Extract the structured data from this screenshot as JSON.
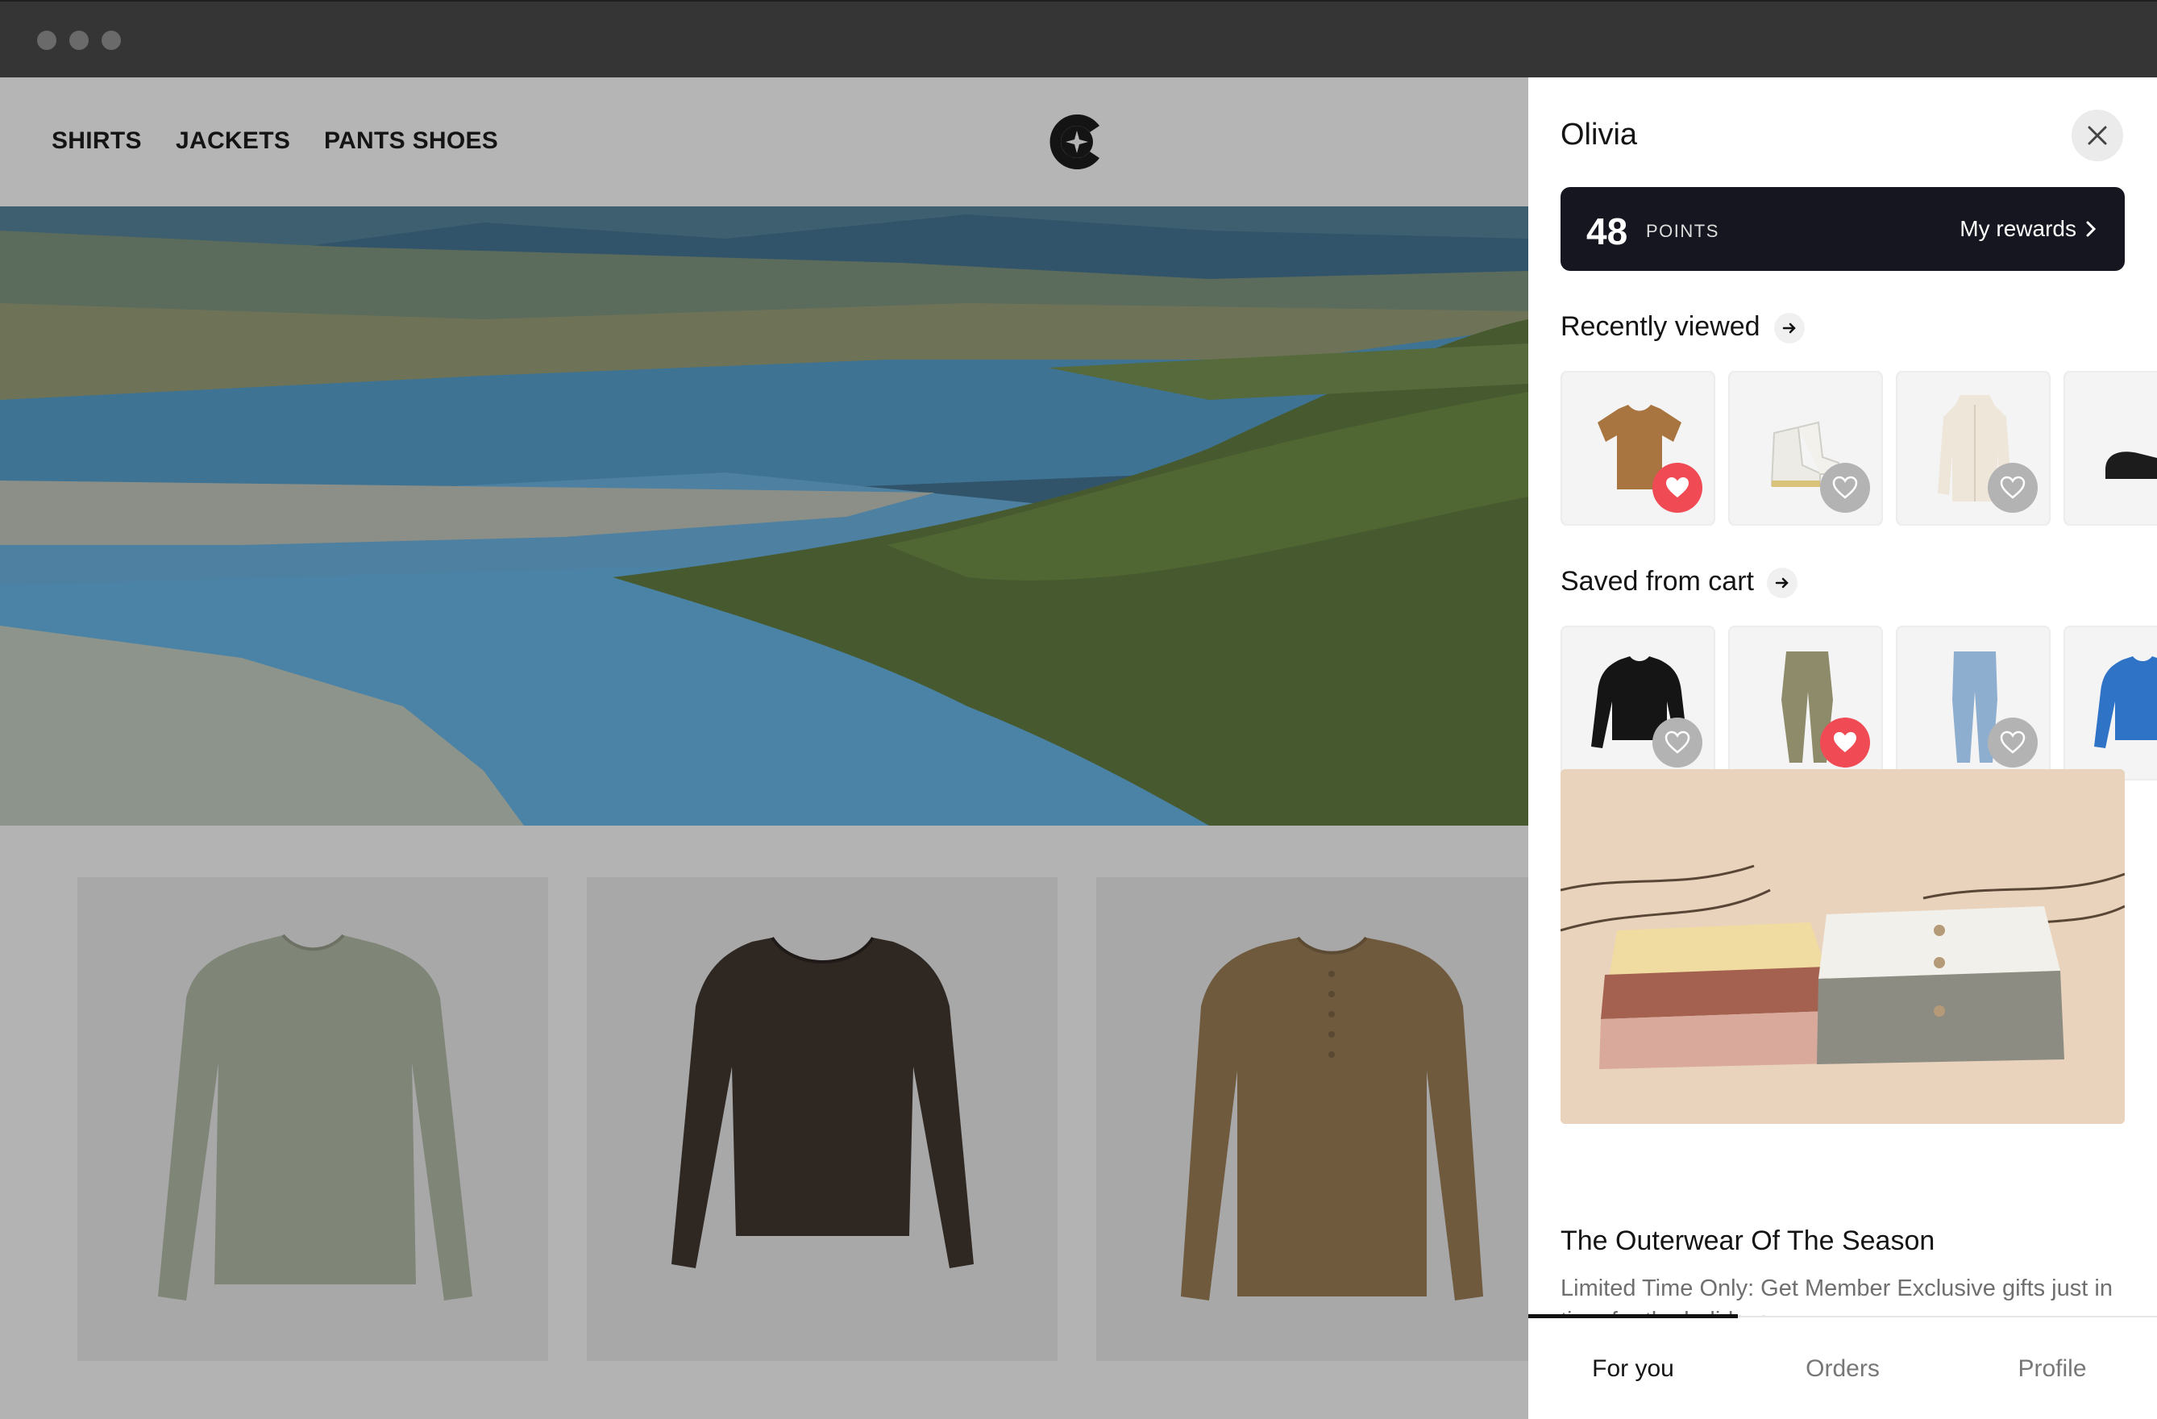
{
  "window": {
    "controls": [
      "close",
      "minimize",
      "zoom"
    ]
  },
  "store": {
    "nav": [
      {
        "label": "SHIRTS"
      },
      {
        "label": "JACKETS"
      },
      {
        "label": "PANTS SHOES"
      }
    ],
    "logo_icon": "brand-c-star-logo",
    "products": [
      {
        "color": "#7f8577",
        "style": "long-sleeve-crew"
      },
      {
        "color": "#2f2722",
        "style": "long-sleeve-scoop"
      },
      {
        "color": "#6f5a3e",
        "style": "henley"
      }
    ]
  },
  "panel": {
    "user_name": "Olivia",
    "close_icon": "close-icon",
    "points": {
      "value": "48",
      "label": "POINTS",
      "link": "My rewards"
    },
    "recently_viewed": {
      "title": "Recently viewed",
      "items": [
        {
          "product": "tan t-shirt",
          "favorited": true
        },
        {
          "product": "white boots",
          "favorited": false
        },
        {
          "product": "cream zip cardigan",
          "favorited": false
        },
        {
          "product": "black loafers",
          "favorited": false
        }
      ]
    },
    "saved_from_cart": {
      "title": "Saved from cart",
      "items": [
        {
          "product": "black sweater",
          "favorited": false
        },
        {
          "product": "olive trousers",
          "favorited": true
        },
        {
          "product": "blue jeans",
          "favorited": false
        },
        {
          "product": "blue knit sweater",
          "favorited": false
        }
      ]
    },
    "promo": {
      "title": "The Outerwear Of The Season",
      "subtitle": "Limited Time Only: Get Member Exclusive gifts just in time for the holidays"
    },
    "tabs": [
      {
        "label": "For you",
        "active": true
      },
      {
        "label": "Orders",
        "active": false
      },
      {
        "label": "Profile",
        "active": false
      }
    ],
    "colors": {
      "accent": "#161620",
      "favorite": "#f04a55",
      "favorite_off": "#b3b3b3"
    }
  }
}
